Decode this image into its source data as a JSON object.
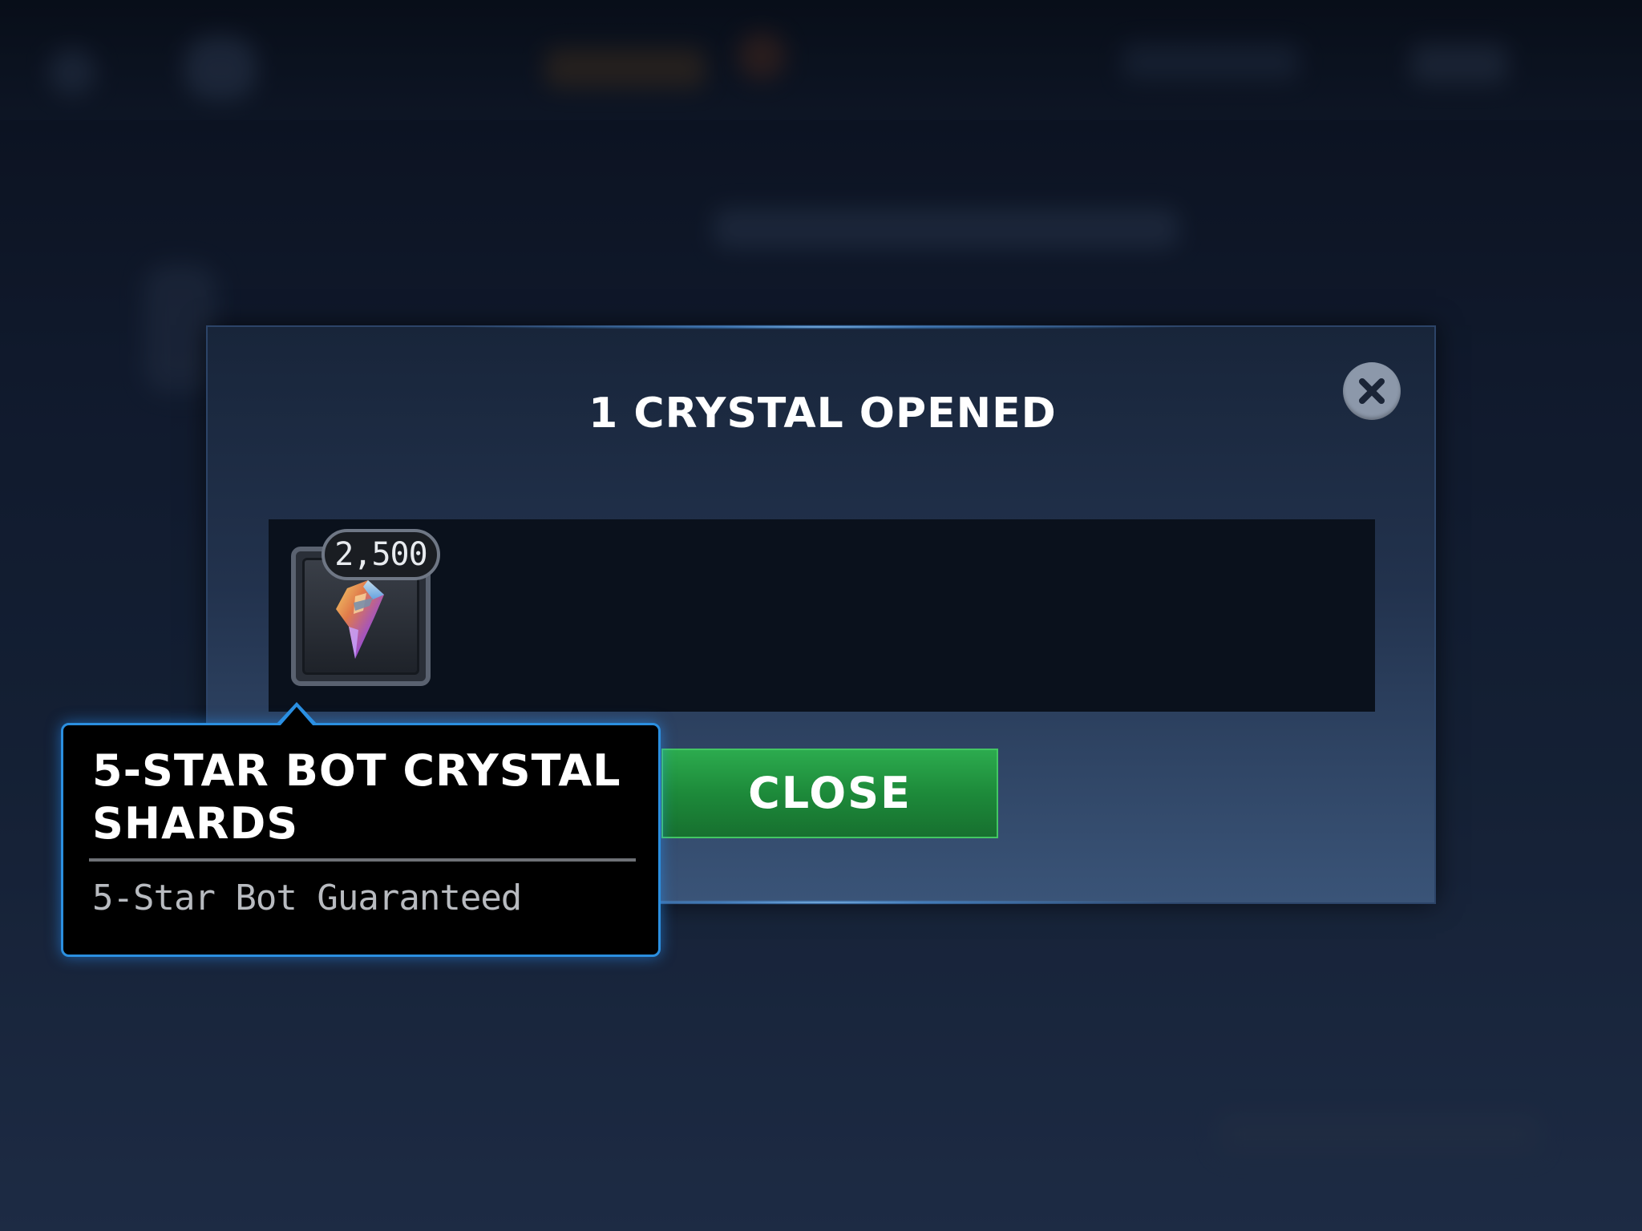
{
  "modal": {
    "title": "1 CRYSTAL OPENED",
    "close_icon": "close-icon",
    "close_button_label": "CLOSE",
    "accent_color": "#2b8fe0",
    "button_color": "#1d8a3a"
  },
  "reward": {
    "quantity": "2,500",
    "icon": "crystal-shard-icon"
  },
  "tooltip": {
    "title": "5-STAR BOT CRYSTAL SHARDS",
    "description": "5-Star Bot Guaranteed"
  }
}
